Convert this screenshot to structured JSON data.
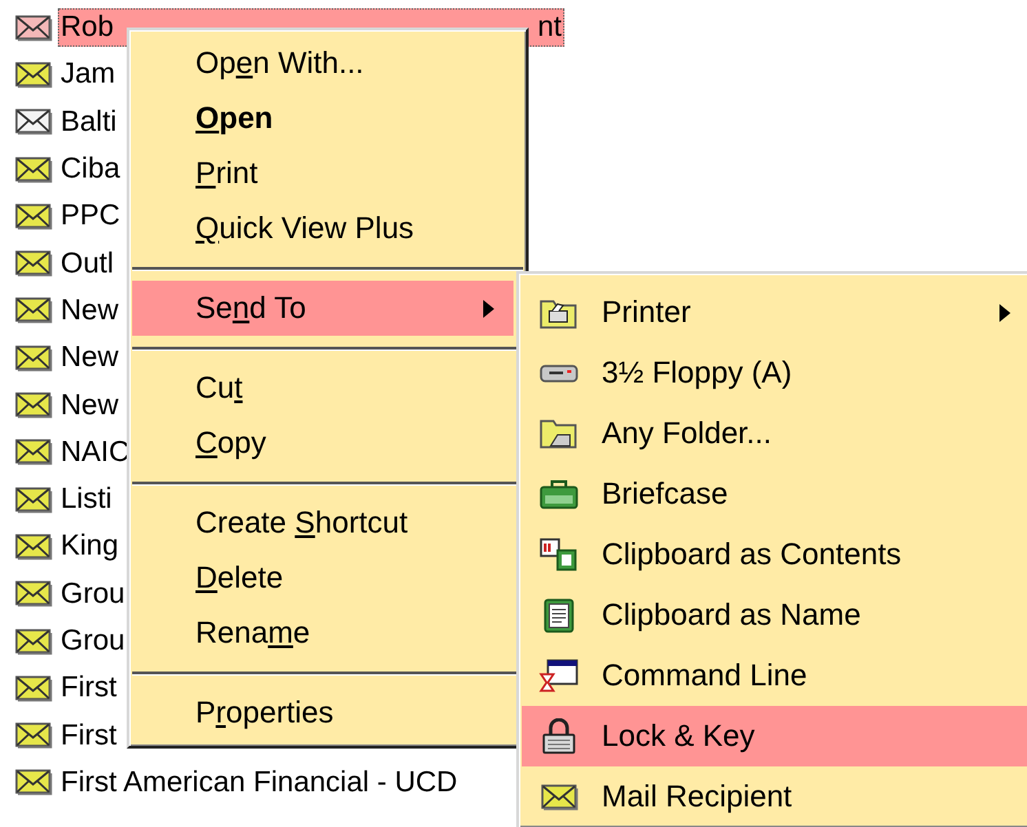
{
  "message_list": {
    "rows": [
      {
        "label": "Rob",
        "label_tail": "nt",
        "unread": false,
        "selected": true
      },
      {
        "label": "Jam",
        "unread": true,
        "selected": false
      },
      {
        "label": "Balti",
        "unread": false,
        "selected": false
      },
      {
        "label": "Ciba",
        "unread": true,
        "selected": false
      },
      {
        "label": "PPC",
        "unread": true,
        "selected": false
      },
      {
        "label": "Outl",
        "unread": true,
        "selected": false
      },
      {
        "label": "New",
        "unread": true,
        "selected": false
      },
      {
        "label": "New",
        "unread": true,
        "selected": false
      },
      {
        "label": "New",
        "unread": true,
        "selected": false
      },
      {
        "label": "NAIC",
        "unread": true,
        "selected": false
      },
      {
        "label": "Listi",
        "unread": true,
        "selected": false
      },
      {
        "label": "King",
        "unread": true,
        "selected": false
      },
      {
        "label": "Grou",
        "unread": true,
        "selected": false
      },
      {
        "label": "Grou",
        "unread": true,
        "selected": false
      },
      {
        "label": "First",
        "unread": true,
        "selected": false
      },
      {
        "label": "First",
        "unread": true,
        "selected": false
      },
      {
        "label": "First American Financial - UCD",
        "unread": true,
        "selected": false
      }
    ]
  },
  "context_menu": {
    "groups": [
      [
        {
          "before": "Op",
          "key": "e",
          "after": "n With...",
          "default": false,
          "selected": false,
          "has_submenu": false
        },
        {
          "key": "O",
          "after": "pen",
          "default": true,
          "selected": false,
          "has_submenu": false
        },
        {
          "key": "P",
          "after": "rint",
          "default": false,
          "selected": false,
          "has_submenu": false
        },
        {
          "key": "Q",
          "after": "uick View Plus",
          "default": false,
          "selected": false,
          "has_submenu": false
        }
      ],
      [
        {
          "before": "Se",
          "key": "n",
          "after": "d To",
          "default": false,
          "selected": true,
          "has_submenu": true
        }
      ],
      [
        {
          "before": "Cu",
          "key": "t",
          "default": false,
          "selected": false,
          "has_submenu": false
        },
        {
          "key": "C",
          "after": "opy",
          "default": false,
          "selected": false,
          "has_submenu": false
        }
      ],
      [
        {
          "before": "Create ",
          "key": "S",
          "after": "hortcut",
          "default": false,
          "selected": false,
          "has_submenu": false
        },
        {
          "key": "D",
          "after": "elete",
          "default": false,
          "selected": false,
          "has_submenu": false
        },
        {
          "before": "Rena",
          "key": "m",
          "after": "e",
          "default": false,
          "selected": false,
          "has_submenu": false
        }
      ],
      [
        {
          "before": "P",
          "key": "r",
          "after": "operties",
          "default": false,
          "selected": false,
          "has_submenu": false
        }
      ]
    ]
  },
  "send_to_menu": {
    "items": [
      {
        "label": "Printer",
        "selected": false,
        "has_submenu": true
      },
      {
        "label": "3½ Floppy (A)",
        "selected": false,
        "has_submenu": false
      },
      {
        "label": "Any Folder...",
        "selected": false,
        "has_submenu": false
      },
      {
        "label": "Briefcase",
        "selected": false,
        "has_submenu": false
      },
      {
        "label": "Clipboard as Contents",
        "selected": false,
        "has_submenu": false
      },
      {
        "label": "Clipboard as Name",
        "selected": false,
        "has_submenu": false
      },
      {
        "label": "Command Line",
        "selected": false,
        "has_submenu": false
      },
      {
        "label": "Lock & Key",
        "selected": true,
        "has_submenu": false
      },
      {
        "label": "Mail Recipient",
        "selected": false,
        "has_submenu": false
      }
    ]
  }
}
